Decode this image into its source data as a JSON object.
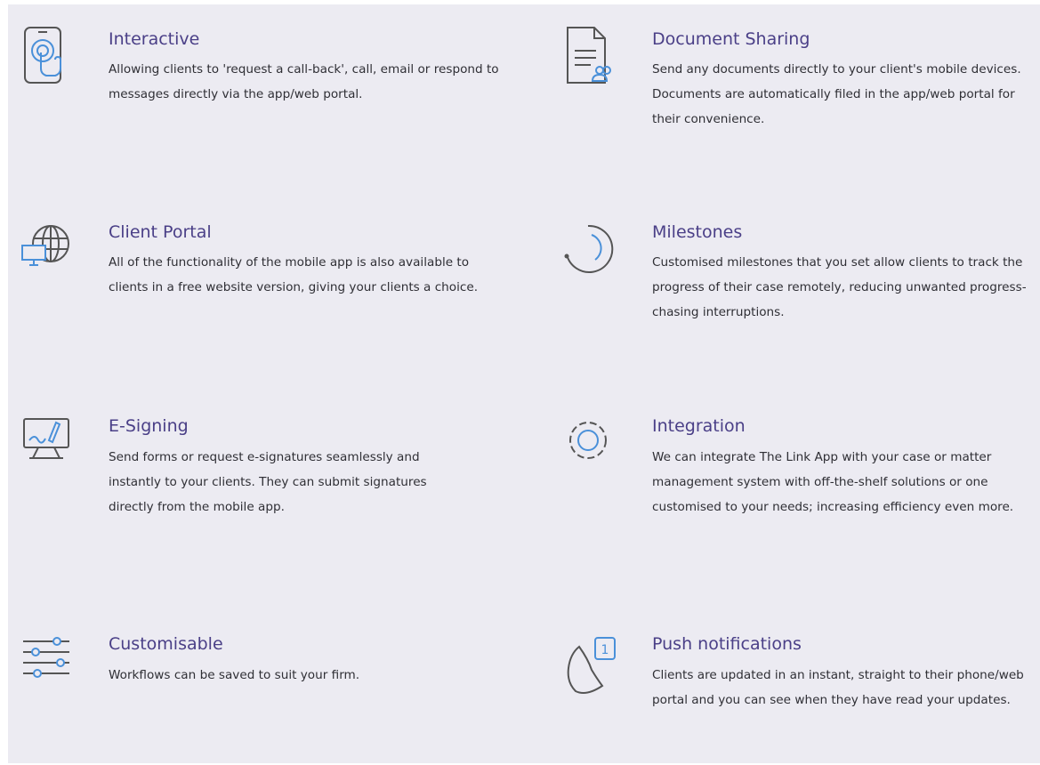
{
  "colors": {
    "background": "#ecebf2",
    "title": "#4a3f87",
    "text": "#2f2f35",
    "icon_line": "#555555",
    "icon_accent": "#4a90d9"
  },
  "features": [
    {
      "title": "Interactive",
      "icon": "touch-screen-icon",
      "description": "Allowing clients to 'request a call-back', call, email or respond to messages directly via the app/web portal."
    },
    {
      "title": "Document Sharing",
      "icon": "document-share-icon",
      "description": "Send any documents directly to your client's mobile devices. Documents are automatically filed in the app/web portal for their convenience."
    },
    {
      "title": "Client Portal",
      "icon": "globe-monitor-icon",
      "description": "All of the functionality of the mobile app is also available to clients in a free website version, giving your clients a choice."
    },
    {
      "title": "Milestones",
      "icon": "progress-arc-icon",
      "description": "Customised milestones that you set allow clients to track the progress of their case remotely, reducing unwanted progress-chasing interruptions."
    },
    {
      "title": "E-Signing",
      "icon": "monitor-pen-icon",
      "description": "Send forms or request e-signatures seamlessly and instantly to your clients. They can submit signatures directly from the mobile app."
    },
    {
      "title": "Integration",
      "icon": "gear-icon",
      "description": "We can integrate The Link App with your case or matter management system with off-the-shelf solutions or one customised to your needs; increasing efficiency even more."
    },
    {
      "title": "Customisable",
      "icon": "sliders-icon",
      "description": "Workflows can be saved to suit your firm."
    },
    {
      "title": "Push notifications",
      "icon": "notification-bell-icon",
      "description": "Clients are updated in an instant, straight to their phone/web portal and you can see when they have read your updates.",
      "badge": "1"
    }
  ]
}
